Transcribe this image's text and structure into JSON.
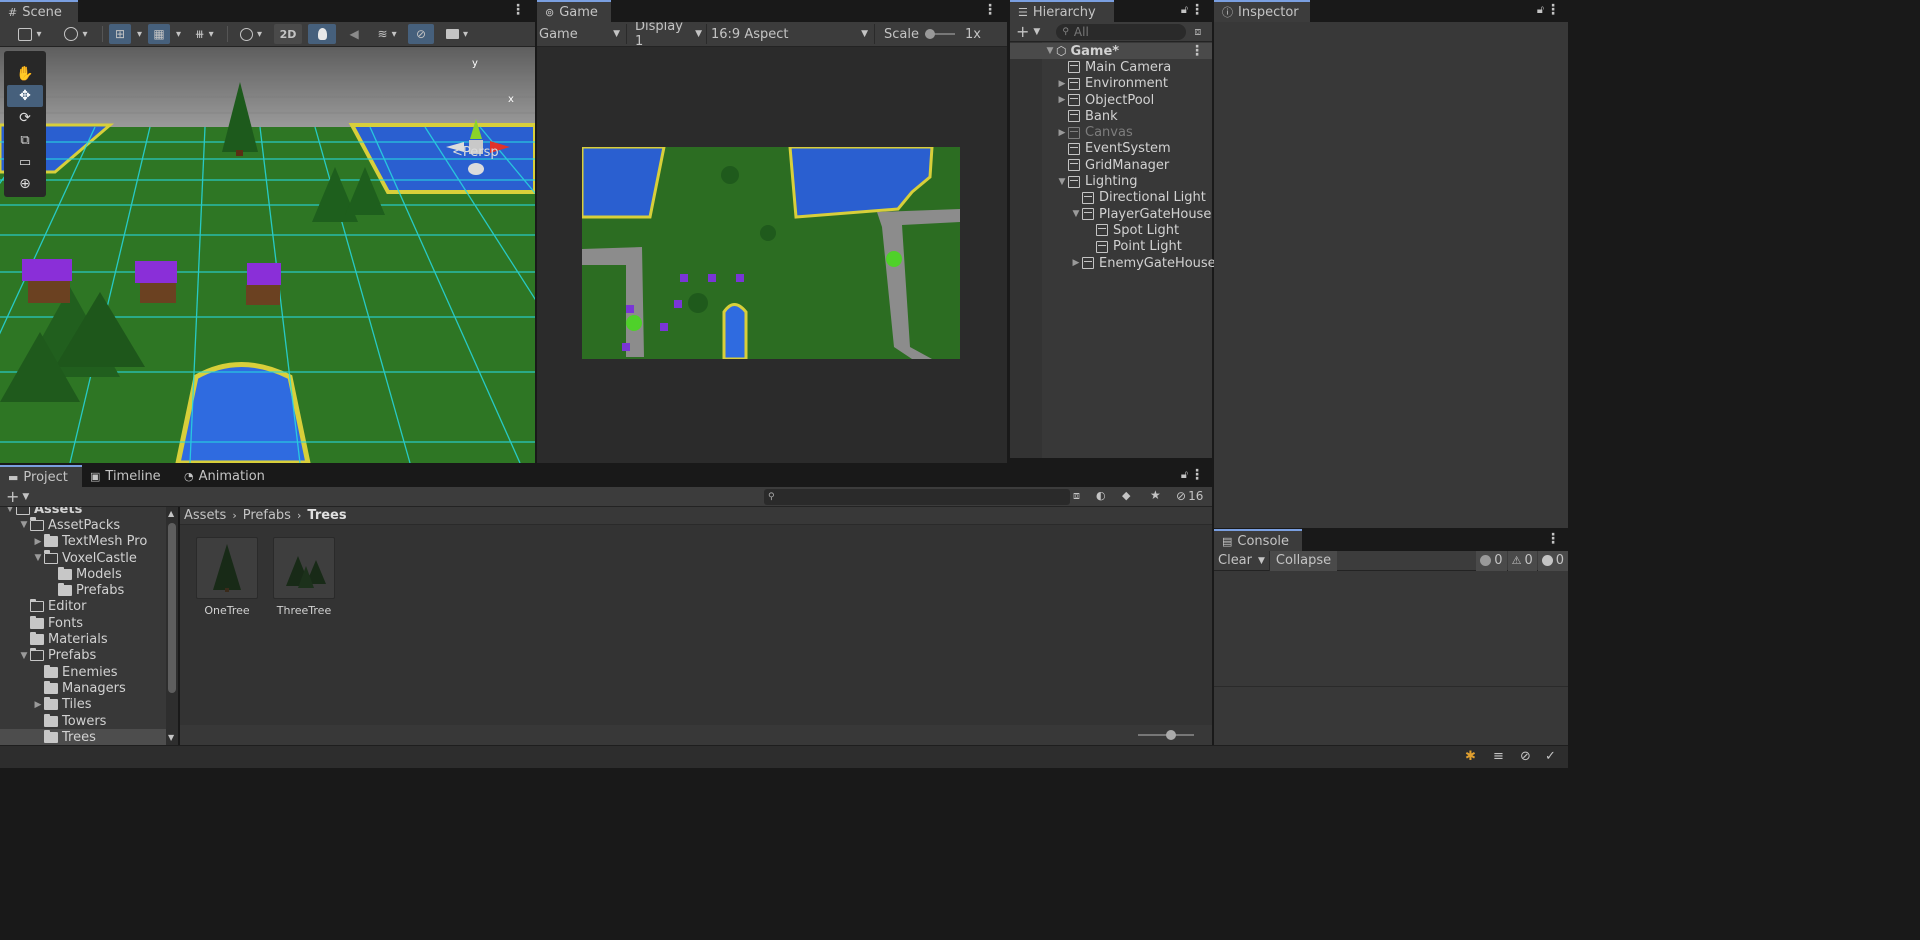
{
  "scene": {
    "tab_label": "Scene",
    "toolbar": {
      "mode_2d": "2D"
    },
    "gizmo": {
      "y_label": "y",
      "x_label": "x",
      "persp_label": "Persp"
    }
  },
  "game": {
    "tab_label": "Game",
    "view_select": "Game",
    "display_select": "Display 1",
    "aspect_select": "16:9 Aspect",
    "scale_label": "Scale",
    "scale_value": "1x"
  },
  "hierarchy": {
    "tab_label": "Hierarchy",
    "search_placeholder": "All",
    "root": "Game*",
    "items": [
      {
        "label": "Main Camera",
        "depth": 0,
        "expander": ""
      },
      {
        "label": "Environment",
        "depth": 0,
        "expander": "collapsed"
      },
      {
        "label": "ObjectPool",
        "depth": 0,
        "expander": "collapsed"
      },
      {
        "label": "Bank",
        "depth": 0,
        "expander": ""
      },
      {
        "label": "Canvas",
        "depth": 0,
        "expander": "collapsed",
        "disabled": true
      },
      {
        "label": "EventSystem",
        "depth": 0,
        "expander": ""
      },
      {
        "label": "GridManager",
        "depth": 0,
        "expander": ""
      },
      {
        "label": "Lighting",
        "depth": 0,
        "expander": "expanded"
      },
      {
        "label": "Directional Light",
        "depth": 1,
        "expander": ""
      },
      {
        "label": "PlayerGateHouse",
        "depth": 1,
        "expander": "expanded"
      },
      {
        "label": "Spot Light",
        "depth": 2,
        "expander": ""
      },
      {
        "label": "Point Light",
        "depth": 2,
        "expander": ""
      },
      {
        "label": "EnemyGateHouse",
        "depth": 1,
        "expander": "collapsed"
      }
    ]
  },
  "inspector": {
    "tab_label": "Inspector"
  },
  "project": {
    "tabs": [
      "Project",
      "Timeline",
      "Animation"
    ],
    "hidden_count": "16",
    "tree": [
      {
        "label": "Assets",
        "depth": 0,
        "expander": "expanded",
        "open": true,
        "bold": true
      },
      {
        "label": "AssetPacks",
        "depth": 1,
        "expander": "expanded",
        "open": true
      },
      {
        "label": "TextMesh Pro",
        "depth": 2,
        "expander": "collapsed"
      },
      {
        "label": "VoxelCastle",
        "depth": 2,
        "expander": "expanded",
        "open": true
      },
      {
        "label": "Models",
        "depth": 3,
        "expander": ""
      },
      {
        "label": "Prefabs",
        "depth": 3,
        "expander": ""
      },
      {
        "label": "Editor",
        "depth": 1,
        "expander": "",
        "outline": true
      },
      {
        "label": "Fonts",
        "depth": 1,
        "expander": ""
      },
      {
        "label": "Materials",
        "depth": 1,
        "expander": ""
      },
      {
        "label": "Prefabs",
        "depth": 1,
        "expander": "expanded",
        "open": true
      },
      {
        "label": "Enemies",
        "depth": 2,
        "expander": ""
      },
      {
        "label": "Managers",
        "depth": 2,
        "expander": ""
      },
      {
        "label": "Tiles",
        "depth": 2,
        "expander": "collapsed"
      },
      {
        "label": "Towers",
        "depth": 2,
        "expander": ""
      },
      {
        "label": "Trees",
        "depth": 2,
        "expander": "",
        "selected": true
      }
    ],
    "breadcrumb": [
      "Assets",
      "Prefabs",
      "Trees"
    ],
    "assets": [
      {
        "label": "OneTree",
        "icon": "one-tree-icon"
      },
      {
        "label": "ThreeTree",
        "icon": "three-tree-icon"
      }
    ]
  },
  "console": {
    "tab_label": "Console",
    "clear_label": "Clear",
    "collapse_label": "Collapse",
    "log_count": "0",
    "warning_count": "0",
    "error_count": "0"
  }
}
